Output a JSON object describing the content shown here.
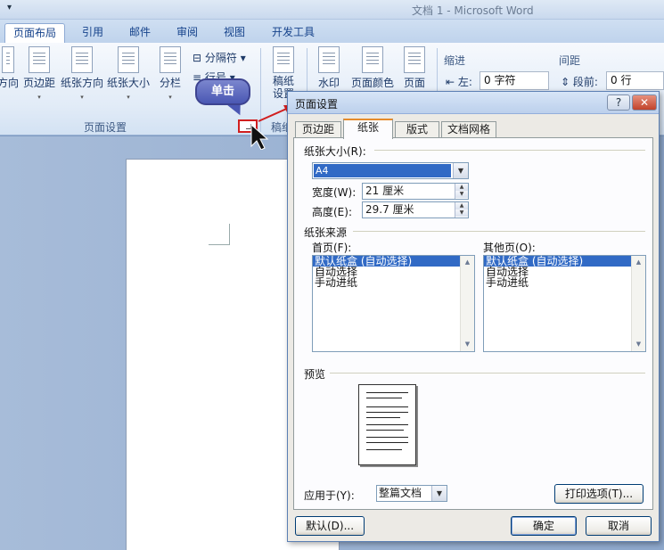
{
  "window": {
    "qat_arrow": "▾",
    "title": "文档 1 - Microsoft Word"
  },
  "ribbon_tabs": [
    "页面布局",
    "引用",
    "邮件",
    "审阅",
    "视图",
    "开发工具"
  ],
  "ribbon": {
    "page_setup_buttons": [
      "方向",
      "页边距",
      "纸张方向",
      "纸张大小",
      "分栏"
    ],
    "separator_button": "分隔符",
    "line_numbers_button": "行号",
    "group_label": "页面设置",
    "manuscript_button": "稿纸设置",
    "manuscript_group": "稿纸",
    "watermark_button": "水印",
    "page_color_button": "页面颜色",
    "page_border_button": "页面",
    "indent_label": "缩进",
    "indent_left_label": "左:",
    "indent_left_value": "0 字符",
    "spacing_label": "间距",
    "spacing_before_label": "段前:",
    "spacing_before_value": "0 行"
  },
  "callout": {
    "text": "单击"
  },
  "dialog": {
    "title": "页面设置",
    "help_label": "?",
    "close_label": "✕",
    "tabs": [
      "页边距",
      "纸张",
      "版式",
      "文档网格"
    ],
    "paper_size_label": "纸张大小(R):",
    "paper_size_value": "A4",
    "width_label": "宽度(W):",
    "width_value": "21 厘米",
    "height_label": "高度(E):",
    "height_value": "29.7 厘米",
    "paper_source_label": "纸张来源",
    "first_page_label": "首页(F):",
    "other_pages_label": "其他页(O):",
    "tray_options": [
      "默认纸盒 (自动选择)",
      "自动选择",
      "手动进纸"
    ],
    "preview_label": "预览",
    "apply_to_label": "应用于(Y):",
    "apply_to_value": "整篇文档",
    "print_options_button": "打印选项(T)...",
    "default_button": "默认(D)...",
    "ok_button": "确定",
    "cancel_button": "取消"
  }
}
